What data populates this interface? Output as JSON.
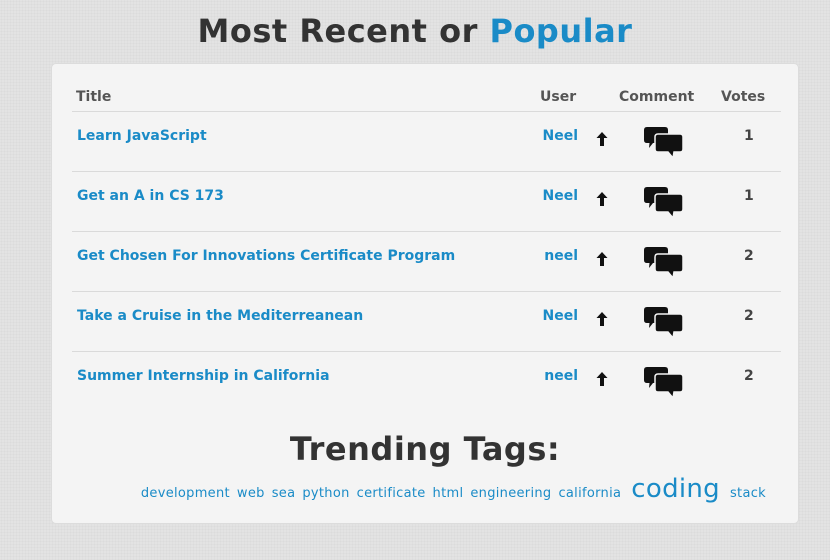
{
  "header": {
    "title_prefix": "Most Recent or ",
    "title_link": "Popular"
  },
  "table": {
    "columns": {
      "title": "Title",
      "user": "User",
      "comment": "Comment",
      "votes": "Votes"
    },
    "rows": [
      {
        "title": "Learn JavaScript",
        "user": "Neel",
        "votes": "1",
        "upvote_icon": "arrow-up-icon",
        "comment_icon": "speech-bubbles-icon"
      },
      {
        "title": "Get an A in CS 173",
        "user": "Neel",
        "votes": "1",
        "upvote_icon": "arrow-up-icon",
        "comment_icon": "speech-bubbles-icon"
      },
      {
        "title": "Get Chosen For Innovations Certificate Program",
        "user": "neel",
        "votes": "2",
        "upvote_icon": "arrow-up-icon",
        "comment_icon": "speech-bubbles-icon"
      },
      {
        "title": "Take a Cruise in the Mediterreanean",
        "user": "Neel",
        "votes": "2",
        "upvote_icon": "arrow-up-icon",
        "comment_icon": "speech-bubbles-icon"
      },
      {
        "title": "Summer Internship in California",
        "user": "neel",
        "votes": "2",
        "upvote_icon": "arrow-up-icon",
        "comment_icon": "speech-bubbles-icon"
      }
    ]
  },
  "trending": {
    "heading": "Trending Tags:",
    "tags": [
      {
        "label": "development"
      },
      {
        "label": "web"
      },
      {
        "label": "sea"
      },
      {
        "label": "python"
      },
      {
        "label": "certificate"
      },
      {
        "label": "html"
      },
      {
        "label": "engineering"
      },
      {
        "label": "california"
      },
      {
        "label": "coding",
        "emphasis": true
      },
      {
        "label": "stack"
      }
    ]
  },
  "colors": {
    "accent": "#1a8bc7",
    "heading": "#333333",
    "background": "#e3e3e3",
    "panel": "#f4f4f4"
  }
}
